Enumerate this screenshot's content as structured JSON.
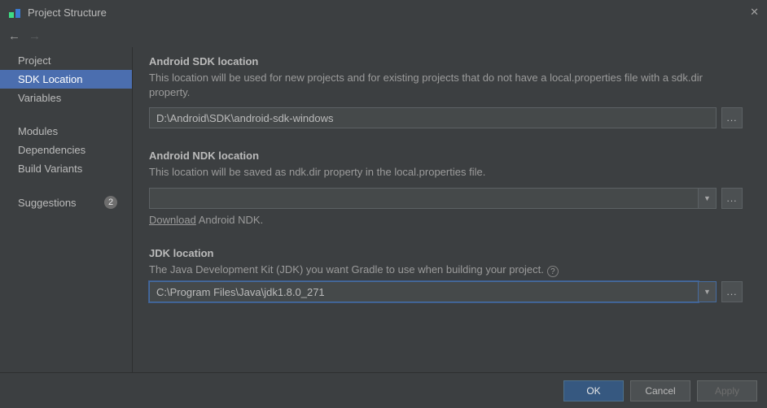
{
  "window": {
    "title": "Project Structure"
  },
  "sidebar": {
    "items": [
      {
        "label": "Project",
        "selected": false
      },
      {
        "label": "SDK Location",
        "selected": true
      },
      {
        "label": "Variables",
        "selected": false
      }
    ],
    "group2": [
      {
        "label": "Modules"
      },
      {
        "label": "Dependencies"
      },
      {
        "label": "Build Variants"
      }
    ],
    "suggestions": {
      "label": "Suggestions",
      "badge": "2"
    }
  },
  "sdk": {
    "heading": "Android SDK location",
    "desc": "This location will be used for new projects and for existing projects that do not have a local.properties file with a sdk.dir property.",
    "value": "D:\\Android\\SDK\\android-sdk-windows"
  },
  "ndk": {
    "heading": "Android NDK location",
    "desc": "This location will be saved as ndk.dir property in the local.properties file.",
    "value": "",
    "downloadLink": "Download",
    "downloadRest": " Android NDK."
  },
  "jdk": {
    "heading": "JDK location",
    "desc": "The Java Development Kit (JDK) you want Gradle to use when building your project.",
    "value": "C:\\Program Files\\Java\\jdk1.8.0_271"
  },
  "buttons": {
    "ok": "OK",
    "cancel": "Cancel",
    "apply": "Apply"
  },
  "browse": "...",
  "helpTip": "?"
}
